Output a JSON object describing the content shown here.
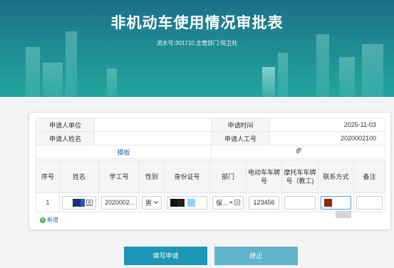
{
  "header": {
    "title": "非机动车使用情况审批表",
    "subtitle": "流水号:301710,主管部门:保卫处"
  },
  "info": {
    "applicant_unit_label": "申请人单位",
    "applicant_unit_value": "",
    "apply_time_label": "申请时间",
    "apply_time_value": "2025-11-03",
    "applicant_name_label": "申请人姓名",
    "applicant_name_value": "",
    "applicant_id_label": "申请人工号",
    "applicant_id_value": "2020002100",
    "template_link": "模板",
    "attachment_icon": "paperclip-icon"
  },
  "table": {
    "headers": [
      "序号",
      "姓名",
      "学工号",
      "性别",
      "身份证号",
      "部门",
      "电动车车牌号",
      "摩托车车牌号（教工)",
      "联系方式",
      "备注"
    ],
    "rows": [
      {
        "index": "1",
        "name": "",
        "student_id": "2020002...",
        "gender": "男",
        "id_number": "",
        "department": "保...",
        "ebike_plate": "123456",
        "moto_plate": "",
        "contact": "",
        "remark": ""
      }
    ]
  },
  "add_row_label": "新增",
  "buttons": {
    "submit": "填写申请",
    "stop": "终止"
  },
  "colors": {
    "banner": "#1f8a93",
    "submit": "#1b96b4",
    "stop": "#62b4cc",
    "link": "#2a6fa8"
  }
}
